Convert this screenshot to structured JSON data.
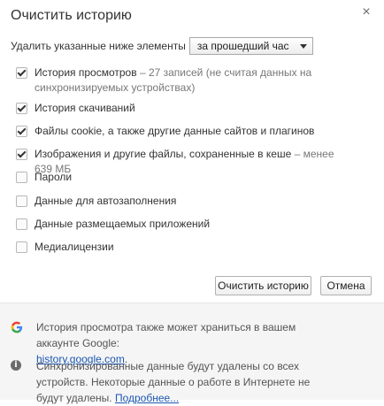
{
  "dialog": {
    "title": "Очистить историю",
    "close_glyph": "×"
  },
  "range": {
    "label": "Удалить указанные ниже элементы",
    "selected": "за прошедший час"
  },
  "items": [
    {
      "label": "История просмотров",
      "detail": "– 27 записей (не считая данных на синхронизируемых устройствах)",
      "checked": true
    },
    {
      "label": "История скачиваний",
      "detail": "",
      "checked": true
    },
    {
      "label": "Файлы cookie, а также другие данные сайтов и плагинов",
      "detail": "",
      "checked": true
    },
    {
      "label": "Изображения и другие файлы, сохраненные в кеше",
      "detail": "– менее 639 МБ",
      "checked": true
    },
    {
      "label": "Пароли",
      "detail": "",
      "checked": false
    },
    {
      "label": "Данные для автозаполнения",
      "detail": "",
      "checked": false
    },
    {
      "label": "Данные размещаемых приложений",
      "detail": "",
      "checked": false
    },
    {
      "label": "Медиалицензии",
      "detail": "",
      "checked": false
    }
  ],
  "buttons": {
    "clear": "Очистить историю",
    "cancel": "Отмена"
  },
  "footer": {
    "google_note": "История просмотра также может храниться в вашем аккаунте Google:",
    "google_link": "history.google.com",
    "google_link_suffix": ".",
    "sync_note": "Синхронизированные данные будут удалены со всех устройств. Некоторые данные о работе в Интернете не будут удалены.",
    "sync_link": "Подробнее..."
  },
  "colors": {
    "link": "#1a57b2",
    "google_blue": "#4285f4",
    "google_red": "#ea4335",
    "google_yellow": "#fbbc05",
    "google_green": "#34a853"
  }
}
